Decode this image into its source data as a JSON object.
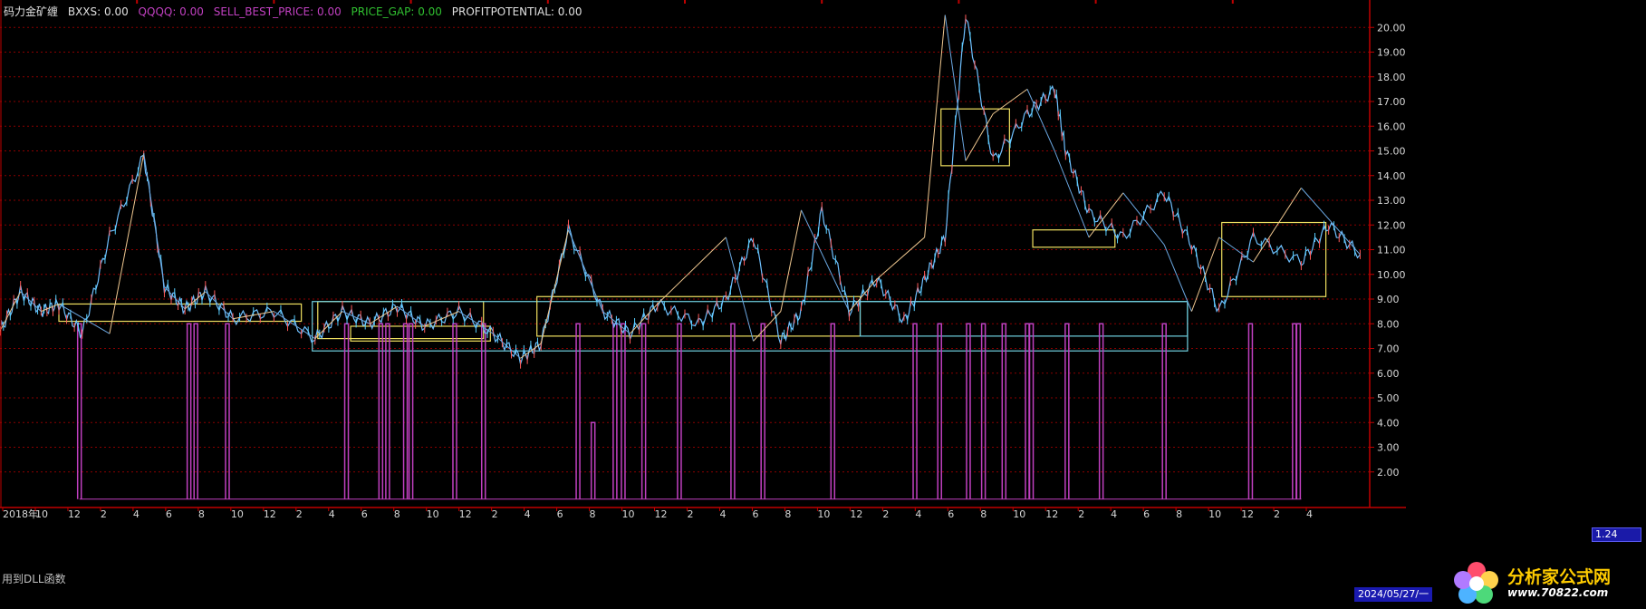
{
  "header": {
    "title": "码力金矿缠",
    "bxxs": "BXXS: 0.00",
    "qqqq": "QQQQ: 0.00",
    "sell_best_price": "SELL_BEST_PRICE: 0.00",
    "price_gap": "PRICE_GAP: 0.00",
    "profit_potential": "PROFITPOTENTIAL: 0.00"
  },
  "footer": {
    "dll_note": "用到DLL函数",
    "current_date": "2024/05/27/一",
    "current_value": "1.24",
    "year_label": "2018年",
    "logo_text": "分析家公式网",
    "logo_url": "www.70822.com"
  },
  "colors": {
    "background": "#000000",
    "grid": "#8a0000",
    "axis": "#c00000",
    "price_line": "#6fc0ff",
    "zigzag_up": "#f0c890",
    "zigzag_down": "#6aa6e0",
    "box_yellow": "#f0e060",
    "box_cyan": "#70d0e0",
    "signal": "#c040c0"
  },
  "chart_data": {
    "type": "line",
    "title": "",
    "xlabel": "",
    "ylabel": "",
    "ylim": [
      1,
      21
    ],
    "y_ticks": [
      "20.00",
      "19.00",
      "18.00",
      "17.00",
      "16.00",
      "15.00",
      "14.00",
      "13.00",
      "12.00",
      "11.00",
      "10.00",
      "9.00",
      "8.00",
      "7.00",
      "6.00",
      "5.00",
      "4.00",
      "3.00",
      "2.00"
    ],
    "x_tick_labels": [
      "2018年",
      "10",
      "12",
      "2",
      "4",
      "6",
      "8",
      "10",
      "12",
      "2",
      "4",
      "6",
      "8",
      "10",
      "12",
      "2",
      "4",
      "6",
      "8",
      "10",
      "12",
      "2",
      "4",
      "6",
      "8",
      "10",
      "12",
      "2",
      "4",
      "6",
      "8",
      "10",
      "12",
      "2",
      "4",
      "6",
      "8",
      "10",
      "12",
      "2",
      "4",
      "2024/05/27/一"
    ],
    "x": [
      0,
      1.5,
      3,
      4.3,
      6,
      8,
      10.5,
      12,
      13.5,
      15,
      17,
      20,
      23,
      25,
      27,
      29,
      31,
      33.5,
      36,
      38,
      39.5,
      41.5,
      44,
      46,
      48,
      51,
      53,
      55,
      57,
      58.5,
      60,
      62,
      64,
      66,
      67.5,
      69,
      70.5,
      72.5,
      75,
      77,
      77.8,
      79.5,
      82,
      85,
      87,
      89,
      91.5,
      95,
      97,
      99.3
    ],
    "series": [
      {
        "values": [
          7.7,
          9.3,
          8.5,
          8.8,
          7.6,
          11.5,
          14.8,
          9.5,
          8.6,
          9.3,
          8.2,
          8.5,
          7.4,
          8.5,
          8.0,
          8.7,
          7.9,
          8.5,
          7.6,
          6.6,
          7.2,
          11.8,
          8.5,
          7.6,
          8.8,
          8.0,
          9.0,
          11.5,
          7.3,
          8.5,
          12.6,
          8.5,
          9.8,
          8.1,
          9.8,
          11.5,
          20.5,
          14.6,
          16.5,
          17.5,
          15.0,
          12.5,
          11.5,
          13.3,
          11.2,
          8.5,
          11.5,
          10.5,
          12.0,
          10.8
        ]
      }
    ],
    "zigzag": {
      "x": [
        0,
        1.5,
        3,
        4.3,
        8,
        10.5,
        12,
        13.5,
        15,
        17,
        20,
        23,
        25,
        27,
        29,
        31,
        33.5,
        36,
        38,
        39.5,
        41.5,
        44,
        46,
        48,
        53,
        55,
        57,
        58.5,
        62,
        64,
        67.5,
        69,
        70.5,
        72.5,
        75,
        77,
        79.5,
        82,
        85,
        87,
        89,
        91.5,
        95,
        99.3
      ],
      "values": [
        7.7,
        9.3,
        8.5,
        8.8,
        7.6,
        14.9,
        9.5,
        8.6,
        9.3,
        8.2,
        8.5,
        7.4,
        8.5,
        8.0,
        8.7,
        7.9,
        8.5,
        7.6,
        6.6,
        7.2,
        11.8,
        8.5,
        7.6,
        8.8,
        11.5,
        7.3,
        8.5,
        12.6,
        8.5,
        9.8,
        11.5,
        20.5,
        14.6,
        16.5,
        17.5,
        15.0,
        11.5,
        13.3,
        11.2,
        8.5,
        11.5,
        10.5,
        13.5,
        10.8
      ]
    },
    "boxes": [
      {
        "color": "yellow",
        "x0": 4.3,
        "x1": 22.0,
        "y0": 8.1,
        "y1": 8.8
      },
      {
        "color": "yellow",
        "x0": 23.2,
        "x1": 35.3,
        "y0": 7.4,
        "y1": 8.9
      },
      {
        "color": "yellow",
        "x0": 25.6,
        "x1": 35.8,
        "y0": 7.3,
        "y1": 7.9
      },
      {
        "color": "cyan",
        "x0": 22.8,
        "x1": 86.7,
        "y0": 6.9,
        "y1": 8.9
      },
      {
        "color": "yellow",
        "x0": 39.2,
        "x1": 62.8,
        "y0": 7.5,
        "y1": 9.1
      },
      {
        "color": "cyan",
        "x0": 62.8,
        "x1": 86.7,
        "y0": 7.5,
        "y1": 8.9
      },
      {
        "color": "yellow",
        "x0": 68.7,
        "x1": 73.7,
        "y0": 14.4,
        "y1": 16.7
      },
      {
        "color": "yellow",
        "x0": 75.4,
        "x1": 81.4,
        "y0": 11.1,
        "y1": 11.8
      },
      {
        "color": "yellow",
        "x0": 89.2,
        "x1": 96.8,
        "y0": 9.1,
        "y1": 12.1
      }
    ],
    "signals": {
      "x": [
        5.8,
        13.8,
        14.3,
        16.6,
        25.3,
        27.8,
        28.3,
        29.6,
        30.0,
        33.2,
        35.3,
        42.2,
        43.3,
        44.9,
        45.5,
        47.0,
        49.6,
        53.5,
        55.7,
        60.8,
        66.8,
        68.6,
        70.7,
        71.8,
        73.3,
        75.0,
        75.3,
        77.9,
        80.4,
        85.0,
        91.3,
        94.5,
        94.8
      ],
      "high": [
        8,
        8,
        8,
        8,
        8,
        8,
        8,
        8,
        8,
        8,
        8,
        8,
        4,
        8,
        8,
        8,
        8,
        8,
        8,
        8,
        8,
        8,
        8,
        8,
        8,
        8,
        8,
        8,
        8,
        8,
        8,
        8,
        8
      ],
      "low": 0.9
    },
    "grid": true,
    "legend": "none"
  }
}
